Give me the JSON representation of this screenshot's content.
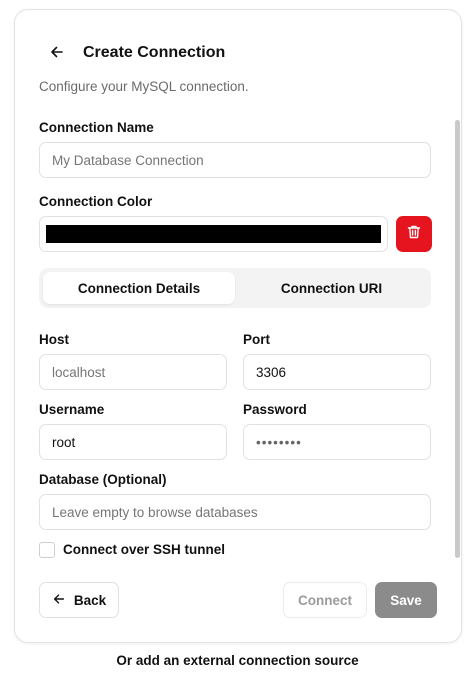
{
  "header": {
    "title": "Create Connection",
    "subtitle": "Configure your MySQL connection."
  },
  "connection_name": {
    "label": "Connection Name",
    "placeholder": "My Database Connection"
  },
  "connection_color": {
    "label": "Connection Color",
    "value": "#000000",
    "delete_icon": "trash-icon",
    "delete_color": "#e5141f"
  },
  "tabs": [
    {
      "label": "Connection Details",
      "active": true
    },
    {
      "label": "Connection URI",
      "active": false
    }
  ],
  "host": {
    "label": "Host",
    "placeholder": "localhost"
  },
  "port": {
    "label": "Port",
    "value": "3306"
  },
  "username": {
    "label": "Username",
    "value": "root"
  },
  "password": {
    "label": "Password",
    "value": "••••••••"
  },
  "database": {
    "label": "Database (Optional)",
    "placeholder": "Leave empty to browse databases"
  },
  "ssh": {
    "label": "Connect over SSH tunnel",
    "checked": false
  },
  "footer": {
    "back_label": "Back",
    "connect_label": "Connect",
    "save_label": "Save"
  },
  "external_link": "Or add an external connection source"
}
